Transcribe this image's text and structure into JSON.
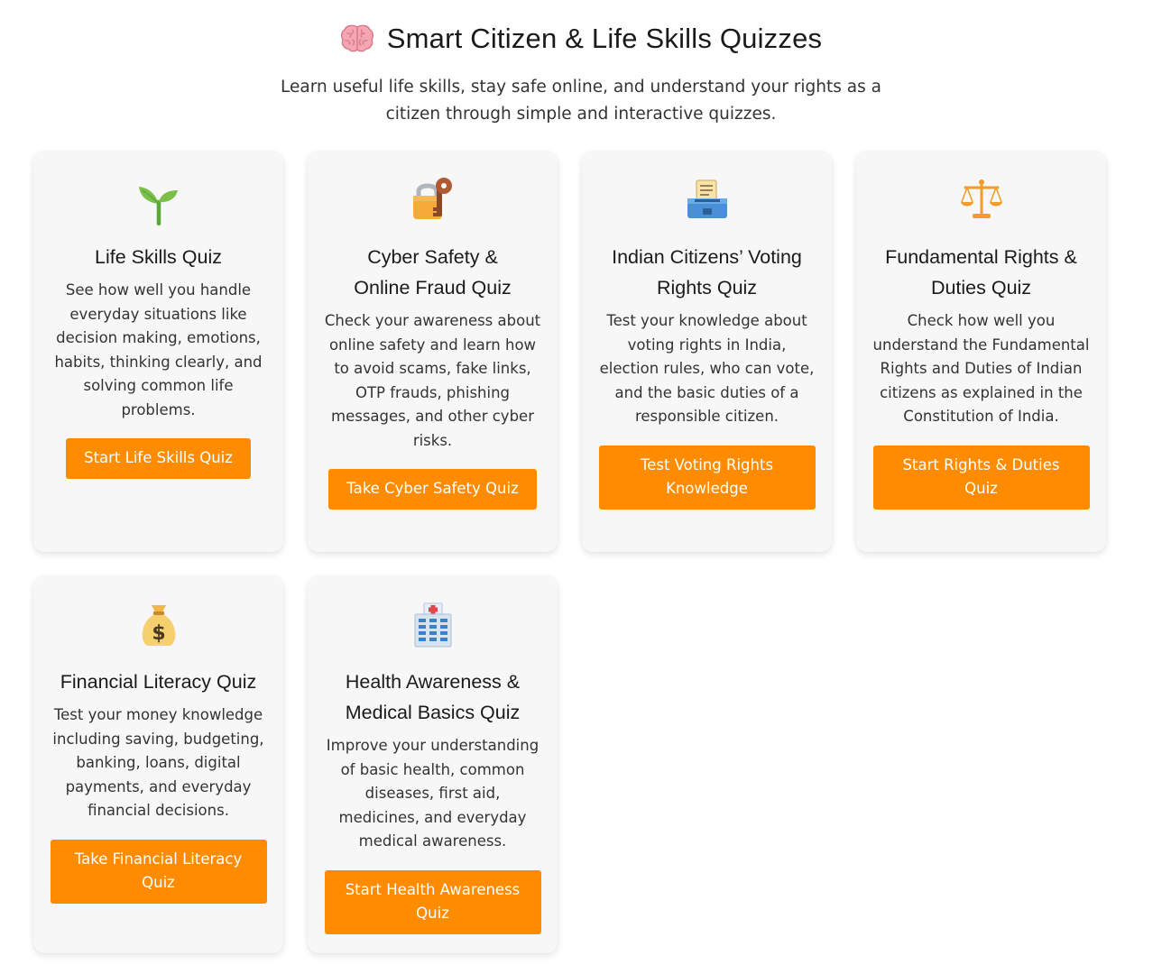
{
  "header": {
    "icon": "brain-icon",
    "title": "Smart Citizen & Life Skills Quizzes",
    "subtitle": "Learn useful life skills, stay safe online, and understand your rights as a citizen through simple and interactive quizzes."
  },
  "colors": {
    "button_bg": "#ff8c00",
    "button_text": "#ffffff",
    "card_bg": "#f7f7f7"
  },
  "cards": [
    {
      "icon": "seedling-icon",
      "title": "Life Skills Quiz",
      "description": "See how well you handle everyday situations like decision making, emotions, habits, thinking clearly, and solving common life problems.",
      "button": "Start Life Skills Quiz"
    },
    {
      "icon": "lock-with-key-icon",
      "title": "Cyber Safety & Online Fraud Quiz",
      "description": "Check your awareness about online safety and learn how to avoid scams, fake links, OTP frauds, phishing messages, and other cyber risks.",
      "button": "Take Cyber Safety Quiz"
    },
    {
      "icon": "ballot-box-icon",
      "title": "Indian Citizens’ Voting Rights Quiz",
      "description": "Test your knowledge about voting rights in India, election rules, who can vote, and the basic duties of a responsible citizen.",
      "button": "Test Voting Rights Knowledge"
    },
    {
      "icon": "scales-icon",
      "title": "Fundamental Rights & Duties Quiz",
      "description": "Check how well you understand the Fundamental Rights and Duties of Indian citizens as explained in the Constitution of India.",
      "button": "Start Rights & Duties Quiz"
    },
    {
      "icon": "money-bag-icon",
      "title": "Financial Literacy Quiz",
      "description": "Test your money knowledge including saving, budgeting, banking, loans, digital payments, and everyday financial decisions.",
      "button": "Take Financial Literacy Quiz"
    },
    {
      "icon": "hospital-icon",
      "title": "Health Awareness & Medical Basics Quiz",
      "description": "Improve your understanding of basic health, common diseases, first aid, medicines, and everyday medical awareness.",
      "button": "Start Health Awareness Quiz"
    }
  ]
}
